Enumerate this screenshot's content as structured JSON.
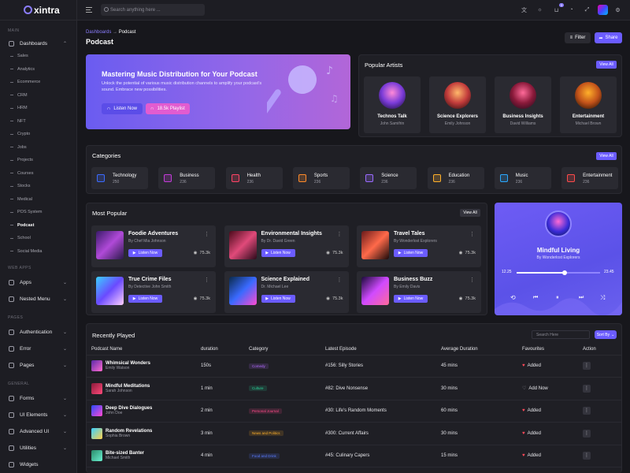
{
  "brand": {
    "name": "xintra"
  },
  "search": {
    "placeholder": "Search anything here ..."
  },
  "header": {
    "badge": "3"
  },
  "sidebar": {
    "main_label": "MAIN",
    "dashboards": "Dashboards",
    "items": [
      "Sales",
      "Analytics",
      "Ecommerce",
      "CRM",
      "HRM",
      "NFT",
      "Crypto",
      "Jobs",
      "Projects",
      "Courses",
      "Stocks",
      "Medical",
      "POS System",
      "Podcast",
      "School",
      "Social Media"
    ],
    "active": "Podcast",
    "web_apps_label": "WEB APPS",
    "apps": "Apps",
    "nested": "Nested Menu",
    "pages_label": "PAGES",
    "authentication": "Authentication",
    "error": "Error",
    "pages": "Pages",
    "general_label": "GENERAL",
    "forms": "Forms",
    "ui": "UI Elements",
    "advanced": "Advanced UI",
    "utilities": "Utilities",
    "widgets": "Widgets"
  },
  "breadcrumb": {
    "parent": "Dashboards",
    "sep": "→",
    "current": "Podcast"
  },
  "page_title": "Podcast",
  "actions": {
    "filter": "Filter",
    "share": "Share"
  },
  "hero": {
    "title": "Mastering Music Distribution for Your Podcast",
    "text": "Unlock the potential of various music distribution channels to amplify your podcast's sound. Embrace new possibilities.",
    "listen": "Listen Now",
    "playlist": "18.5k Playlist"
  },
  "artists": {
    "title": "Popular Artists",
    "view_all": "View All",
    "list": [
      {
        "name": "Technos Talk",
        "by": "John Samifrin"
      },
      {
        "name": "Science Explorers",
        "by": "Emily Johnson"
      },
      {
        "name": "Business Insights",
        "by": "David Williams"
      },
      {
        "name": "Entertainment",
        "by": "Michael Brown"
      }
    ]
  },
  "categories": {
    "title": "Categories",
    "view_all": "View All",
    "list": [
      {
        "name": "Technology",
        "count": "250",
        "color": "#3b6bff"
      },
      {
        "name": "Business",
        "count": "236",
        "color": "#c23bd8"
      },
      {
        "name": "Health",
        "count": "236",
        "color": "#ff4466"
      },
      {
        "name": "Sports",
        "count": "236",
        "color": "#ff8a2a"
      },
      {
        "name": "Science",
        "count": "236",
        "color": "#9a6bff"
      },
      {
        "name": "Education",
        "count": "236",
        "color": "#ffb02a"
      },
      {
        "name": "Music",
        "count": "236",
        "color": "#2aa9ff"
      },
      {
        "name": "Entertainment",
        "count": "236",
        "color": "#ff4a4a"
      }
    ]
  },
  "popular": {
    "title": "Most Popular",
    "view_all": "View All",
    "list": [
      {
        "title": "Foodie Adventures",
        "by": "By Chef Mia Johnson",
        "btn": "Listen Now",
        "views": "75.3k"
      },
      {
        "title": "Environmental Insights",
        "by": "By Dr. David Green",
        "btn": "Listen Now",
        "views": "75.3k"
      },
      {
        "title": "Travel Tales",
        "by": "By Wonderlost Explorers",
        "btn": "Listen Now",
        "views": "75.3k"
      },
      {
        "title": "True Crime Files",
        "by": "By Detective John Smith",
        "btn": "Listen Now",
        "views": "75.3k"
      },
      {
        "title": "Science Explained",
        "by": "Dr. Michael Lee",
        "btn": "Listen Now",
        "views": "75.3k"
      },
      {
        "title": "Business Buzz",
        "by": "By Emily Davis",
        "btn": "Listen Now",
        "views": "75.3k"
      }
    ]
  },
  "player": {
    "title": "Mindful Living",
    "by": "By Wonderlost Explorers",
    "current": "12.25",
    "total": "23.45",
    "progress": 0.58
  },
  "recent": {
    "title": "Recently Played",
    "search_placeholder": "Search Here",
    "sort": "Sort By",
    "columns": [
      "Podcast Name",
      "duration",
      "Category",
      "Latest Episode",
      "Average Duration",
      "Favourites",
      "Action"
    ],
    "rows": [
      {
        "name": "Whimsical Wonders",
        "by": "Emily Watson",
        "duration": "150s",
        "category": "Comedy",
        "cat_color": "#b26bff",
        "episode": "#156: Silly Stories",
        "avg": "45 mins",
        "fav": "Added",
        "fav_on": true
      },
      {
        "name": "Mindful Meditations",
        "by": "Sarah Johnson",
        "duration": "1 min",
        "category": "Culture",
        "cat_color": "#2ad49a",
        "episode": "#82: Dive Nonsense",
        "avg": "30 mins",
        "fav": "Add Now",
        "fav_on": false
      },
      {
        "name": "Deep Dive Dialogues",
        "by": "John Doe",
        "duration": "2 min",
        "category": "Personal Journal",
        "cat_color": "#ff4a8a",
        "episode": "#30: Life's Random Moments",
        "avg": "60 mins",
        "fav": "Added",
        "fav_on": true
      },
      {
        "name": "Random Revelations",
        "by": "Sophia Brown",
        "duration": "3 min",
        "category": "News and Politics",
        "cat_color": "#ffb02a",
        "episode": "#300: Current Affairs",
        "avg": "30 mins",
        "fav": "Added",
        "fav_on": true
      },
      {
        "name": "Bite-sized Banter",
        "by": "Michael Smith",
        "duration": "4 min",
        "category": "Food and Drink",
        "cat_color": "#5a7bff",
        "episode": "#45: Culinary Capers",
        "avg": "15 mins",
        "fav": "Added",
        "fav_on": true
      }
    ]
  }
}
